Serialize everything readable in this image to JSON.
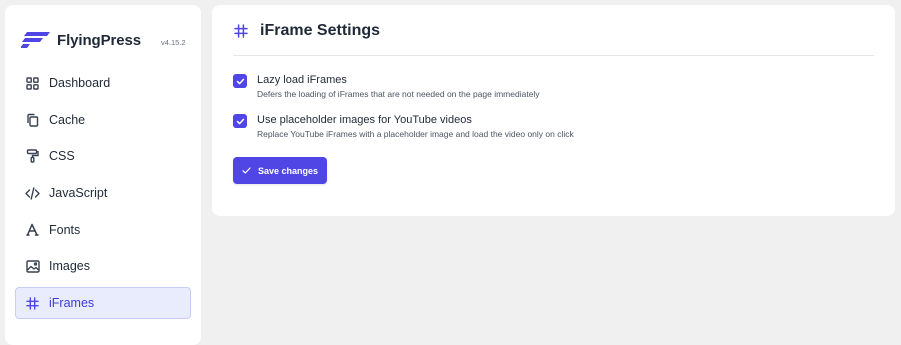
{
  "brand": {
    "name": "FlyingPress",
    "version": "v4.15.2",
    "logo_color": "#4f46e5"
  },
  "sidebar": {
    "items": [
      {
        "label": "Dashboard",
        "icon": "grid-icon",
        "active": false
      },
      {
        "label": "Cache",
        "icon": "copy-icon",
        "active": false
      },
      {
        "label": "CSS",
        "icon": "paint-roller-icon",
        "active": false
      },
      {
        "label": "JavaScript",
        "icon": "code-icon",
        "active": false
      },
      {
        "label": "Fonts",
        "icon": "font-icon",
        "active": false
      },
      {
        "label": "Images",
        "icon": "image-icon",
        "active": false
      },
      {
        "label": "iFrames",
        "icon": "hash-icon",
        "active": true
      }
    ]
  },
  "main": {
    "title": "iFrame Settings",
    "title_icon": "hash-icon",
    "options": [
      {
        "label": "Lazy load iFrames",
        "description": "Defers the loading of iFrames that are not needed on the page immediately",
        "checked": true
      },
      {
        "label": "Use placeholder images for YouTube videos",
        "description": "Replace YouTube iFrames with a placeholder image and load the video only on click",
        "checked": true
      }
    ],
    "save_label": "Save changes"
  },
  "colors": {
    "accent": "#4f46e5",
    "active_nav_bg": "#e9ecfc",
    "page_bg": "#f0f0f1"
  }
}
